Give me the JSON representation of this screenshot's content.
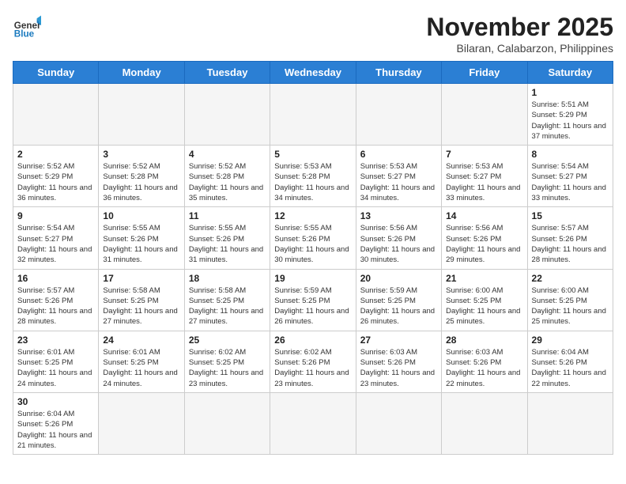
{
  "header": {
    "logo_general": "General",
    "logo_blue": "Blue",
    "month_title": "November 2025",
    "location": "Bilaran, Calabarzon, Philippines"
  },
  "weekdays": [
    "Sunday",
    "Monday",
    "Tuesday",
    "Wednesday",
    "Thursday",
    "Friday",
    "Saturday"
  ],
  "days": {
    "1": {
      "sunrise": "5:51 AM",
      "sunset": "5:29 PM",
      "daylight": "11 hours and 37 minutes."
    },
    "2": {
      "sunrise": "5:52 AM",
      "sunset": "5:29 PM",
      "daylight": "11 hours and 36 minutes."
    },
    "3": {
      "sunrise": "5:52 AM",
      "sunset": "5:28 PM",
      "daylight": "11 hours and 36 minutes."
    },
    "4": {
      "sunrise": "5:52 AM",
      "sunset": "5:28 PM",
      "daylight": "11 hours and 35 minutes."
    },
    "5": {
      "sunrise": "5:53 AM",
      "sunset": "5:28 PM",
      "daylight": "11 hours and 34 minutes."
    },
    "6": {
      "sunrise": "5:53 AM",
      "sunset": "5:27 PM",
      "daylight": "11 hours and 34 minutes."
    },
    "7": {
      "sunrise": "5:53 AM",
      "sunset": "5:27 PM",
      "daylight": "11 hours and 33 minutes."
    },
    "8": {
      "sunrise": "5:54 AM",
      "sunset": "5:27 PM",
      "daylight": "11 hours and 33 minutes."
    },
    "9": {
      "sunrise": "5:54 AM",
      "sunset": "5:27 PM",
      "daylight": "11 hours and 32 minutes."
    },
    "10": {
      "sunrise": "5:55 AM",
      "sunset": "5:26 PM",
      "daylight": "11 hours and 31 minutes."
    },
    "11": {
      "sunrise": "5:55 AM",
      "sunset": "5:26 PM",
      "daylight": "11 hours and 31 minutes."
    },
    "12": {
      "sunrise": "5:55 AM",
      "sunset": "5:26 PM",
      "daylight": "11 hours and 30 minutes."
    },
    "13": {
      "sunrise": "5:56 AM",
      "sunset": "5:26 PM",
      "daylight": "11 hours and 30 minutes."
    },
    "14": {
      "sunrise": "5:56 AM",
      "sunset": "5:26 PM",
      "daylight": "11 hours and 29 minutes."
    },
    "15": {
      "sunrise": "5:57 AM",
      "sunset": "5:26 PM",
      "daylight": "11 hours and 28 minutes."
    },
    "16": {
      "sunrise": "5:57 AM",
      "sunset": "5:26 PM",
      "daylight": "11 hours and 28 minutes."
    },
    "17": {
      "sunrise": "5:58 AM",
      "sunset": "5:25 PM",
      "daylight": "11 hours and 27 minutes."
    },
    "18": {
      "sunrise": "5:58 AM",
      "sunset": "5:25 PM",
      "daylight": "11 hours and 27 minutes."
    },
    "19": {
      "sunrise": "5:59 AM",
      "sunset": "5:25 PM",
      "daylight": "11 hours and 26 minutes."
    },
    "20": {
      "sunrise": "5:59 AM",
      "sunset": "5:25 PM",
      "daylight": "11 hours and 26 minutes."
    },
    "21": {
      "sunrise": "6:00 AM",
      "sunset": "5:25 PM",
      "daylight": "11 hours and 25 minutes."
    },
    "22": {
      "sunrise": "6:00 AM",
      "sunset": "5:25 PM",
      "daylight": "11 hours and 25 minutes."
    },
    "23": {
      "sunrise": "6:01 AM",
      "sunset": "5:25 PM",
      "daylight": "11 hours and 24 minutes."
    },
    "24": {
      "sunrise": "6:01 AM",
      "sunset": "5:25 PM",
      "daylight": "11 hours and 24 minutes."
    },
    "25": {
      "sunrise": "6:02 AM",
      "sunset": "5:25 PM",
      "daylight": "11 hours and 23 minutes."
    },
    "26": {
      "sunrise": "6:02 AM",
      "sunset": "5:26 PM",
      "daylight": "11 hours and 23 minutes."
    },
    "27": {
      "sunrise": "6:03 AM",
      "sunset": "5:26 PM",
      "daylight": "11 hours and 23 minutes."
    },
    "28": {
      "sunrise": "6:03 AM",
      "sunset": "5:26 PM",
      "daylight": "11 hours and 22 minutes."
    },
    "29": {
      "sunrise": "6:04 AM",
      "sunset": "5:26 PM",
      "daylight": "11 hours and 22 minutes."
    },
    "30": {
      "sunrise": "6:04 AM",
      "sunset": "5:26 PM",
      "daylight": "11 hours and 21 minutes."
    }
  },
  "labels": {
    "sunrise": "Sunrise:",
    "sunset": "Sunset:",
    "daylight": "Daylight:"
  }
}
